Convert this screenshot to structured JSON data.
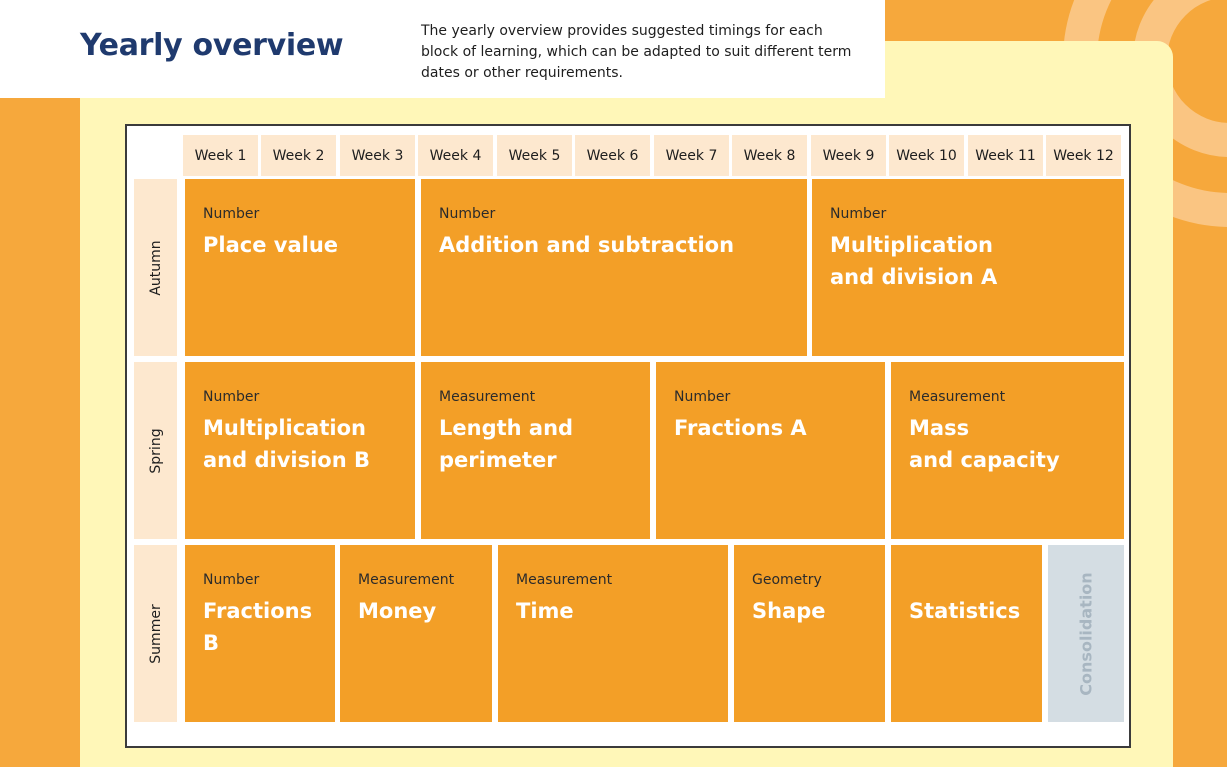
{
  "header": {
    "title": "Yearly overview",
    "intro": "The yearly overview provides suggested timings for each block of learning, which can be adapted to suit different term dates or other requirements."
  },
  "weeks": [
    "Week 1",
    "Week 2",
    "Week 3",
    "Week 4",
    "Week 5",
    "Week 6",
    "Week 7",
    "Week 8",
    "Week 9",
    "Week 10",
    "Week 11",
    "Week 12"
  ],
  "terms": [
    {
      "name": "Autumn",
      "blocks": [
        {
          "category": "Number",
          "title": "Place value",
          "weeks": 3
        },
        {
          "category": "Number",
          "title": "Addition and subtraction",
          "weeks": 5
        },
        {
          "category": "Number",
          "title": "Multiplication\nand division A",
          "weeks": 4
        }
      ]
    },
    {
      "name": "Spring",
      "blocks": [
        {
          "category": "Number",
          "title": "Multiplication\nand division B",
          "weeks": 3
        },
        {
          "category": "Measurement",
          "title": "Length and\nperimeter",
          "weeks": 3
        },
        {
          "category": "Number",
          "title": "Fractions A",
          "weeks": 3
        },
        {
          "category": "Measurement",
          "title": "Mass\nand capacity",
          "weeks": 3
        }
      ]
    },
    {
      "name": "Summer",
      "blocks": [
        {
          "category": "Number",
          "title": "Fractions B",
          "weeks": 2
        },
        {
          "category": "Measurement",
          "title": "Money",
          "weeks": 2
        },
        {
          "category": "Measurement",
          "title": "Time",
          "weeks": 3
        },
        {
          "category": "Geometry",
          "title": "Shape",
          "weeks": 2
        },
        {
          "category": "",
          "title": "Statistics",
          "weeks": 2
        }
      ],
      "consolidation": {
        "label": "Consolidation",
        "weeks": 1
      }
    }
  ],
  "colors": {
    "background": "#f6a83c",
    "panel": "#fff7b8",
    "block": "#f39f27",
    "header_cell": "#fde8cf",
    "title": "#1f3a6e",
    "consolidation": "#d4dde3"
  }
}
